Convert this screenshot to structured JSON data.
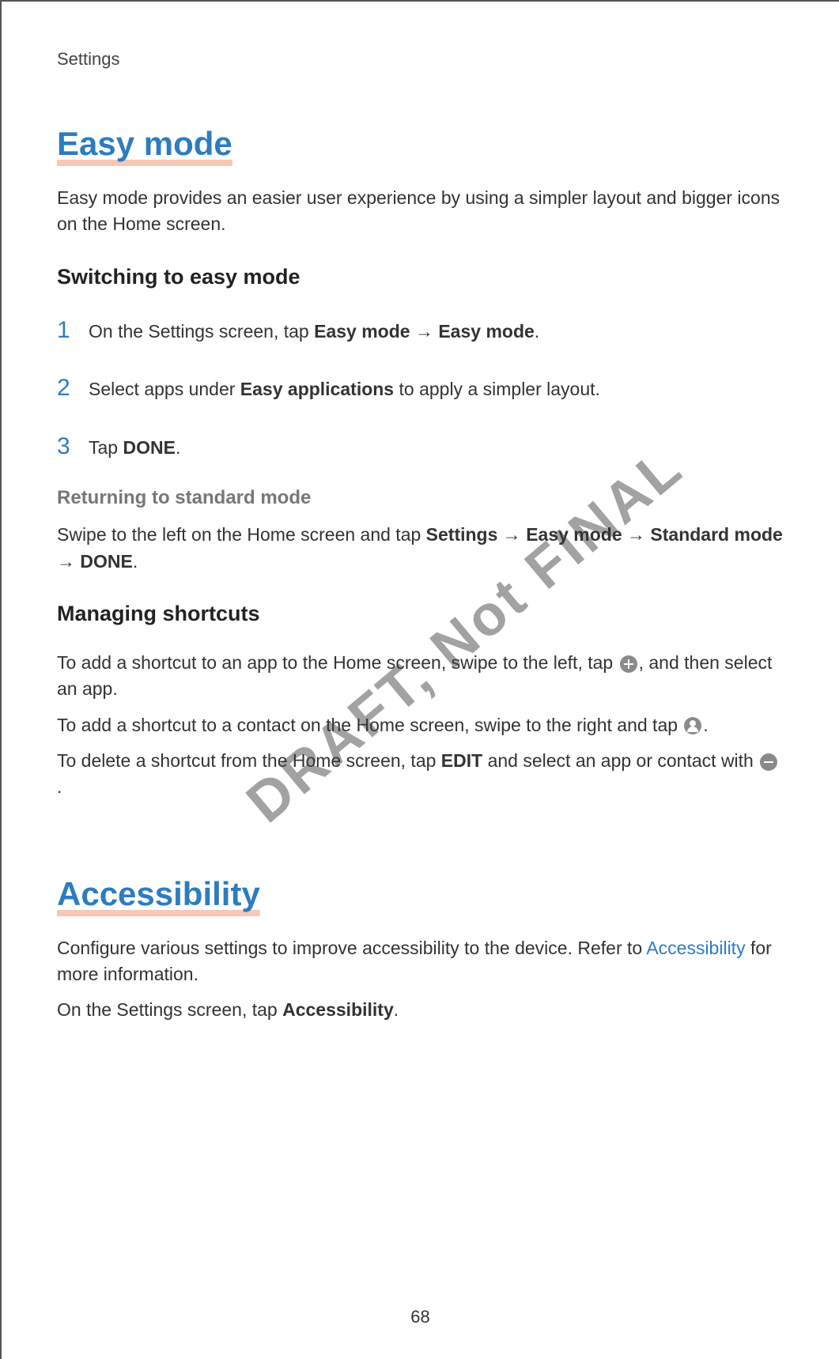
{
  "header": {
    "label": "Settings"
  },
  "watermark": "DRAFT, Not FINAL",
  "page_number": "68",
  "easy_mode": {
    "title": "Easy mode",
    "intro": "Easy mode provides an easier user experience by using a simpler layout and bigger icons on the Home screen.",
    "switching": {
      "heading": "Switching to easy mode",
      "steps": [
        {
          "num": "1",
          "pre": "On the Settings screen, tap ",
          "b1": "Easy mode",
          "arrow": " → ",
          "b2": "Easy mode",
          "post": "."
        },
        {
          "num": "2",
          "pre": "Select apps under ",
          "b1": "Easy applications",
          "post": " to apply a simpler layout."
        },
        {
          "num": "3",
          "pre": "Tap ",
          "b1": "DONE",
          "post": "."
        }
      ]
    },
    "returning": {
      "heading": "Returning to standard mode",
      "text_pre": "Swipe to the left on the Home screen and tap ",
      "b1": "Settings",
      "a1": " → ",
      "b2": "Easy mode",
      "a2": " → ",
      "b3": "Standard mode",
      "a3": " → ",
      "b4": "DONE",
      "post": "."
    },
    "shortcuts": {
      "heading": "Managing shortcuts",
      "p1_pre": "To add a shortcut to an app to the Home screen, swipe to the left, tap ",
      "p1_post": ", and then select an app.",
      "p2_pre": "To add a shortcut to a contact on the Home screen, swipe to the right and tap ",
      "p2_post": ".",
      "p3_pre": "To delete a shortcut from the Home screen, tap ",
      "p3_b": "EDIT",
      "p3_mid": " and select an app or contact with ",
      "p3_post": "."
    }
  },
  "accessibility": {
    "title": "Accessibility",
    "p1_pre": "Configure various settings to improve accessibility to the device. Refer to ",
    "p1_link": "Accessibility",
    "p1_post": " for more information.",
    "p2_pre": "On the Settings screen, tap ",
    "p2_b": "Accessibility",
    "p2_post": "."
  }
}
